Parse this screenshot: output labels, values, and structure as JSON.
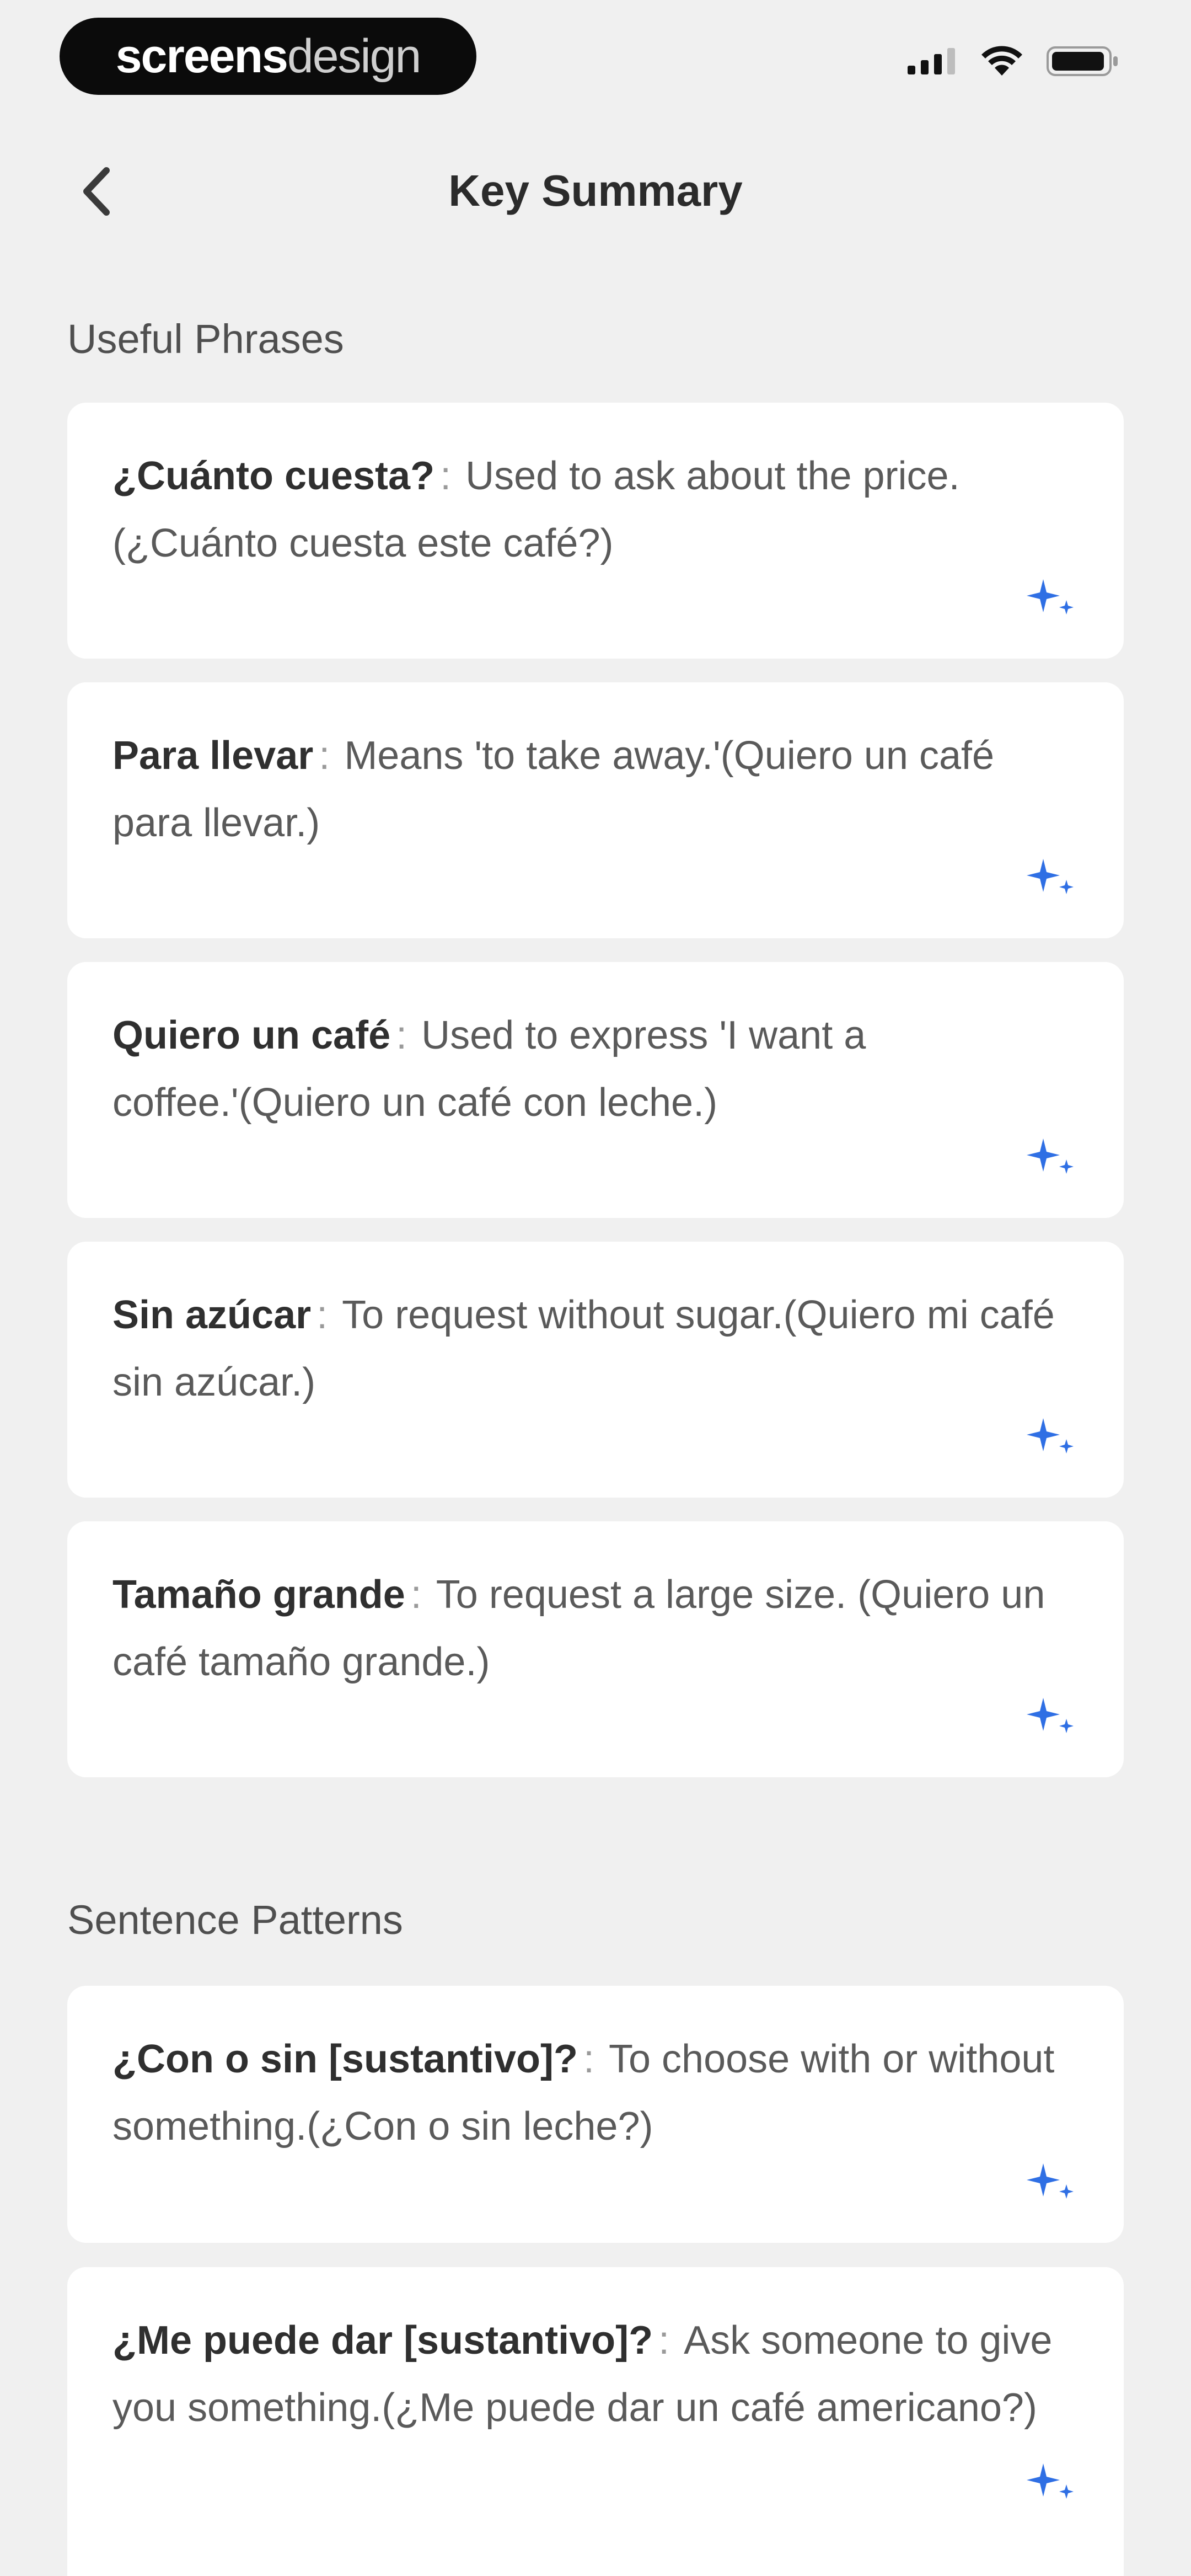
{
  "status_bar": {
    "brand_part1": "screens",
    "brand_part2": "design",
    "icons": [
      "cellular-signal-icon",
      "wifi-icon",
      "battery-icon"
    ]
  },
  "nav": {
    "back_icon": "chevron-left-icon",
    "title": "Key Summary"
  },
  "sections": [
    {
      "title": "Useful Phrases",
      "items": [
        {
          "term": "¿Cuánto cuesta?",
          "description": "Used to ask about the price.(¿Cuánto cuesta este café?)"
        },
        {
          "term": "Para llevar",
          "description": "Means 'to take away.'(Quiero un café para llevar.)"
        },
        {
          "term": "Quiero un café",
          "description": "Used to express 'I want a coffee.'(Quiero un café con leche.)"
        },
        {
          "term": "Sin azúcar",
          "description": "To request without sugar.(Quiero mi café sin azúcar.)"
        },
        {
          "term": "Tamaño grande",
          "description": "To request a large size. (Quiero un café tamaño grande.)"
        }
      ]
    },
    {
      "title": "Sentence Patterns",
      "items": [
        {
          "term": "¿Con o sin [sustantivo]?",
          "description": "To choose with or without something.(¿Con o sin leche?)"
        },
        {
          "term": "¿Me puede dar [sustantivo]?",
          "description": "Ask someone to give you something.(¿Me puede dar un café americano?)"
        }
      ]
    }
  ],
  "separator": ":",
  "item_icon": "sparkle-icon",
  "colors": {
    "background": "#f0f0f0",
    "card": "#ffffff",
    "accent": "#2f6fe4",
    "title_text": "#2b2b2b"
  }
}
